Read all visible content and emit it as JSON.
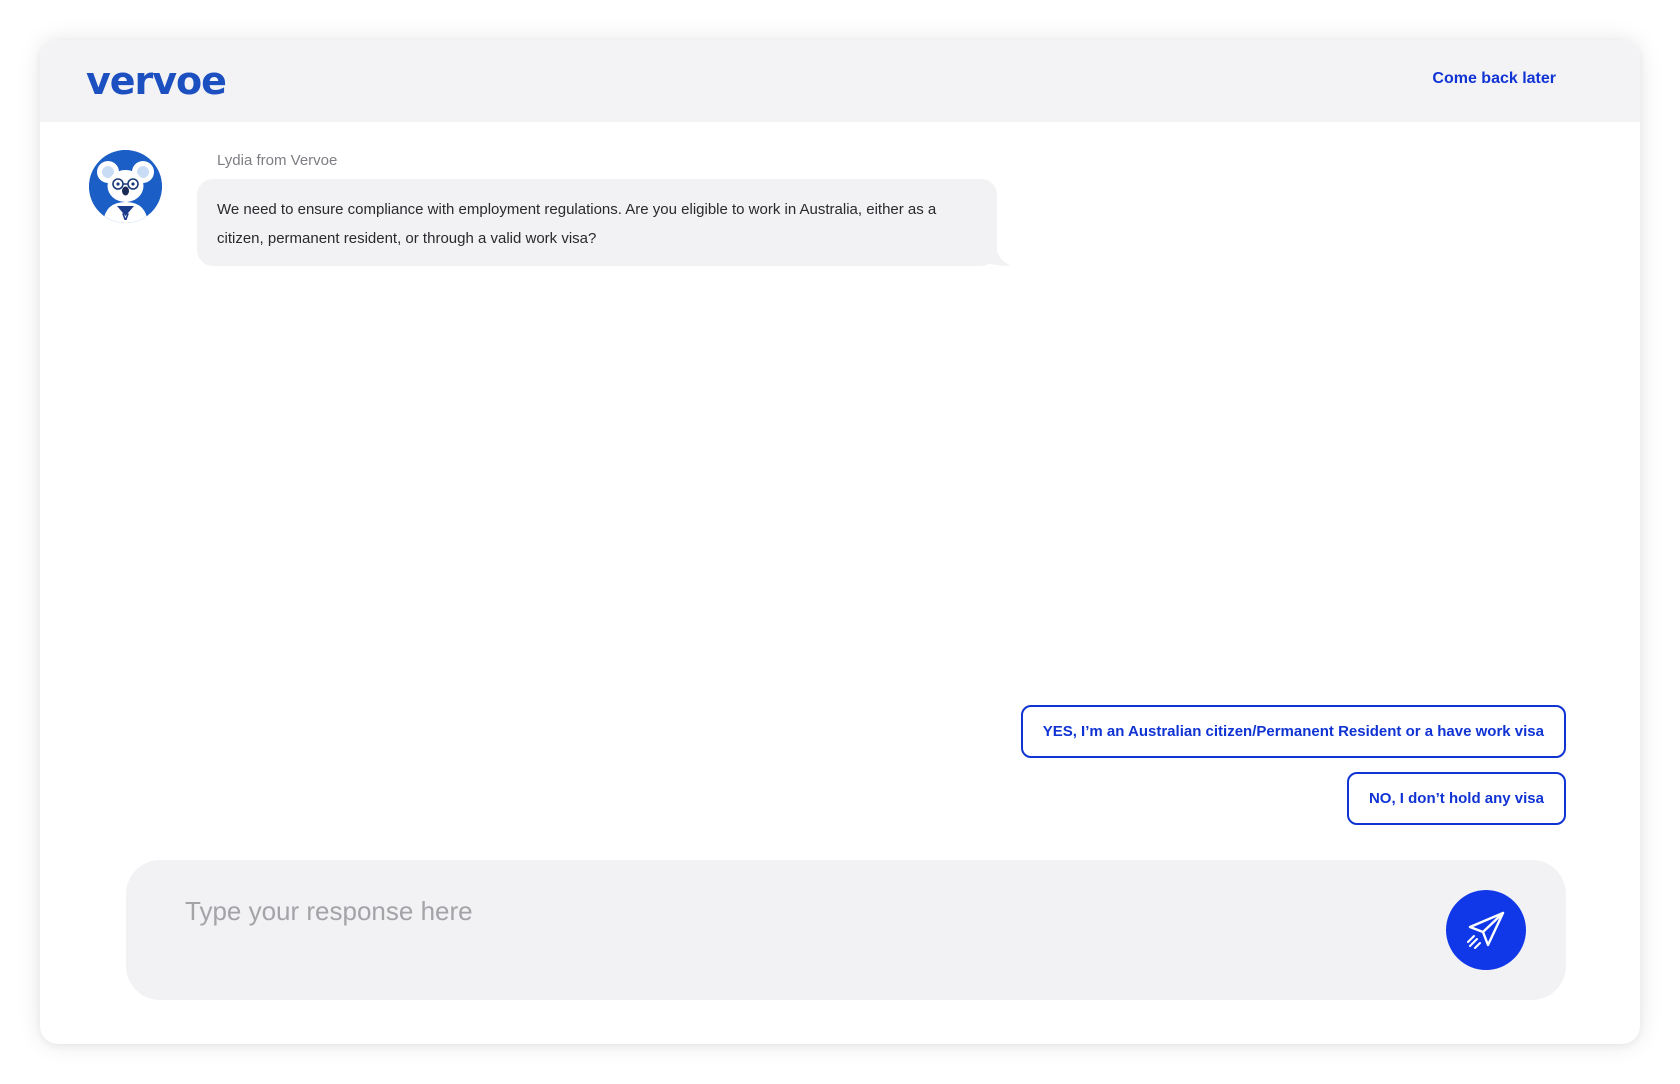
{
  "header": {
    "logo_text": "vervoe",
    "come_back_label": "Come back later"
  },
  "chat": {
    "sender_name": "Lydia from Vervoe",
    "avatar_icon": "koala-avatar-icon",
    "message": "We need to ensure compliance with employment regulations. Are you eligible to work in Australia, either as a citizen, permanent resident, or through a valid work visa?"
  },
  "options": {
    "yes_label": "YES, I’m an Australian citizen/Permanent Resident or a have work visa",
    "no_label": "NO, I don’t hold any visa"
  },
  "composer": {
    "placeholder": "Type your response here",
    "send_icon": "paper-plane-icon"
  },
  "colors": {
    "brand": "#1c4fc0",
    "accent": "#1033d4",
    "send_button": "#1038e8",
    "bubble_bg": "#f2f2f4",
    "header_bg": "#f3f3f5"
  }
}
